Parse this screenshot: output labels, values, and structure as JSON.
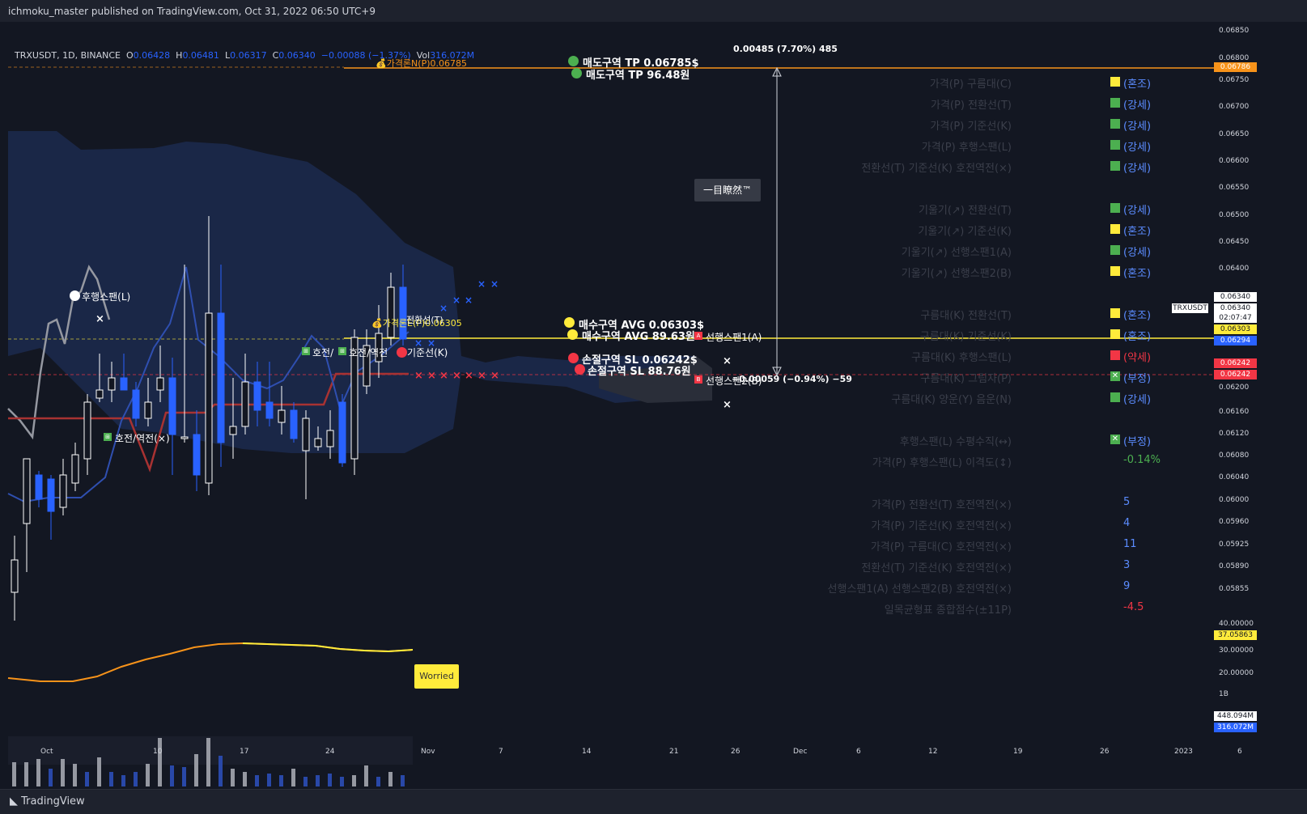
{
  "header": {
    "published": "ichmoku_master published on TradingView.com, Oct 31, 2022 06:50 UTC+9"
  },
  "legend": {
    "symbol": "TRXUSDT, 1D, BINANCE",
    "o_label": "O",
    "o": "0.06428",
    "h_label": "H",
    "h": "0.06481",
    "l_label": "L",
    "l": "0.06317",
    "c_label": "C",
    "c": "0.06340",
    "change": "−0.00088 (−1.37%)",
    "vol_label": "Vol",
    "vol": "316.072M"
  },
  "footer": {
    "logo": "TradingView"
  },
  "annotations": {
    "measure": "0.00485 (7.70%) 485",
    "measure_down": "−0.00059 (−0.94%) −59",
    "tooltip": "一目瞭然™",
    "sell_tp_usd": "매도구역 TP 0.06785$",
    "sell_tp_krw": "매도구역 TP 96.48원",
    "buy_avg_usd": "매수구역 AVG 0.06303$",
    "buy_avg_krw": "매수구역 AVG 89.63원",
    "sl_usd": "손절구역 SL 0.06242$",
    "sl_krw": "손절구역 SL 88.76원",
    "price_n": "💰가격론N(P)0.06785",
    "price_e": "💰가격론E(P)0.06305",
    "lagging": "후행스팬(L)",
    "turn": "호전/역전(×)",
    "turn2": "호전/",
    "turn3": "호전/역전",
    "kijun": "기준선(K)",
    "tenkan": "전환선(T)",
    "spanA": "선행스팬1(A)",
    "spanB": "선행스팬2(B)",
    "worried": "Worried"
  },
  "panel": {
    "rows": [
      {
        "label": "가격(P) 구름대(C)",
        "status": "(혼조)",
        "color": "#ffeb3b"
      },
      {
        "label": "가격(P) 전환선(T)",
        "status": "(강세)",
        "color": "#4caf50"
      },
      {
        "label": "가격(P) 기준선(K)",
        "status": "(강세)",
        "color": "#4caf50"
      },
      {
        "label": "가격(P) 후행스팬(L)",
        "status": "(강세)",
        "color": "#4caf50"
      },
      {
        "label": "전환선(T) 기준선(K) 호전역전(×)",
        "status": "(강세)",
        "color": "#4caf50"
      },
      {
        "label": "기울기(↗) 전환선(T)",
        "status": "(강세)",
        "color": "#4caf50"
      },
      {
        "label": "기울기(↗) 기준선(K)",
        "status": "(혼조)",
        "color": "#ffeb3b"
      },
      {
        "label": "기울기(↗) 선행스팬1(A)",
        "status": "(강세)",
        "color": "#4caf50"
      },
      {
        "label": "기울기(↗) 선행스팬2(B)",
        "status": "(혼조)",
        "color": "#ffeb3b"
      },
      {
        "label": "구름대(K) 전환선(T)",
        "status": "(혼조)",
        "color": "#ffeb3b"
      },
      {
        "label": "구름대(K) 기준선(K)",
        "status": "(혼조)",
        "color": "#ffeb3b"
      },
      {
        "label": "구름대(K) 후행스팬(L)",
        "status": "(약세)",
        "color": "#f23645"
      },
      {
        "label": "구름대(K) 그림자(P)",
        "status": "(부정)",
        "color": "#4caf50"
      },
      {
        "label": "구름대(K) 양운(Y) 음운(N)",
        "status": "(강세)",
        "color": "#4caf50"
      },
      {
        "label": "후행스팬(L) 수평수직(↔)",
        "status": "(부정)",
        "color": "#4caf50"
      },
      {
        "label": "가격(P) 후행스팬(L) 이격도(↕)",
        "value": "-0.14%",
        "color": "#4caf50"
      },
      {
        "label": "가격(P) 전환선(T) 호전역전(×)",
        "value": "5",
        "color": "#5b8cff"
      },
      {
        "label": "가격(P) 기준선(K) 호전역전(×)",
        "value": "4",
        "color": "#5b8cff"
      },
      {
        "label": "가격(P) 구름대(C) 호전역전(×)",
        "value": "11",
        "color": "#5b8cff"
      },
      {
        "label": "전환선(T) 기준선(K) 호전역전(×)",
        "value": "3",
        "color": "#5b8cff"
      },
      {
        "label": "선행스팬1(A) 선행스팬2(B) 호전역전(×)",
        "value": "9",
        "color": "#5b8cff"
      },
      {
        "label": "일목균형표 종합점수(±11P)",
        "value": "-4.5",
        "color": "#f23645"
      }
    ]
  },
  "price_axis": {
    "ticks": [
      "0.06850",
      "0.06800",
      "0.06750",
      "0.06700",
      "0.06650",
      "0.06600",
      "0.06550",
      "0.06500",
      "0.06450",
      "0.06400",
      "0.06200",
      "0.06160",
      "0.06120",
      "0.06080",
      "0.06040",
      "0.06000",
      "0.05960",
      "0.05925",
      "0.05890",
      "0.05855",
      "40.00000",
      "30.00000",
      "20.00000",
      "1B"
    ],
    "tags": {
      "tp": "0.06786",
      "close": "0.06340",
      "symbol": "TRXUSDT",
      "last": "0.06340",
      "countdown": "02:07:47",
      "avg": "0.06303",
      "tenkan": "0.06294",
      "sl1": "0.06242",
      "sl2": "0.06242",
      "osc": "37.05863",
      "vol_ma": "448.094M",
      "vol": "316.072M"
    }
  },
  "time_axis": {
    "ticks": [
      "Oct",
      "10",
      "17",
      "24",
      "Nov",
      "7",
      "14",
      "21",
      "26",
      "Dec",
      "6",
      "12",
      "19",
      "26",
      "2023",
      "6"
    ]
  },
  "colors": {
    "background": "#131722",
    "up": "#ffffff",
    "down": "#2962ff",
    "cloud": "#1c2a4e",
    "tp_line": "#f7931a",
    "avg_line": "#ffeb3b",
    "sl_line": "#f23645"
  }
}
